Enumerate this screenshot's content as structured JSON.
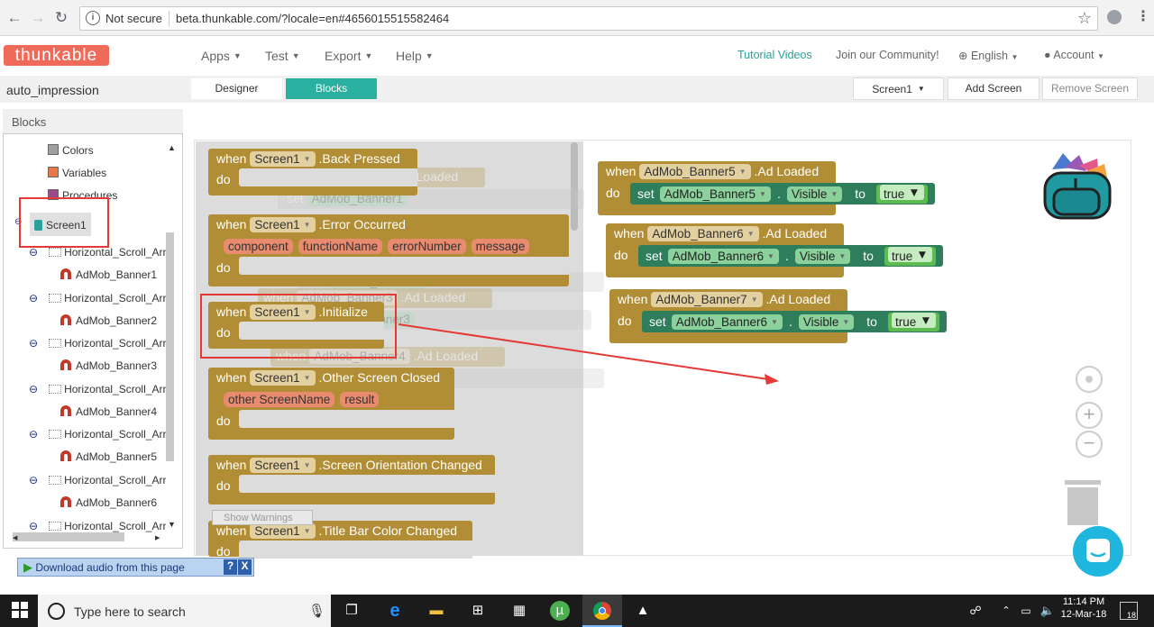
{
  "browser": {
    "security": "Not secure",
    "url": "beta.thunkable.com/?locale=en#4656015515582464"
  },
  "app": {
    "logo": "thunkable",
    "nav": [
      "Apps",
      "Test",
      "Export",
      "Help"
    ],
    "tutorial": "Tutorial Videos",
    "community": "Join our Community!",
    "language": "English",
    "account": "Account",
    "project_name": "auto_impression",
    "tabs": {
      "designer": "Designer",
      "blocks": "Blocks"
    },
    "screen_select": "Screen1",
    "add_screen": "Add Screen",
    "remove_screen": "Remove Screen"
  },
  "blocks_panel": {
    "title": "Blocks",
    "builtins": [
      {
        "label": "Colors",
        "color": "#a0a0a0"
      },
      {
        "label": "Variables",
        "color": "#e8784a"
      },
      {
        "label": "Procedures",
        "color": "#9a4a8a"
      }
    ],
    "screen": "Screen1",
    "tree": [
      {
        "parent": "Horizontal_Scroll_Arr",
        "child": "AdMob_Banner1"
      },
      {
        "parent": "Horizontal_Scroll_Arr",
        "child": "AdMob_Banner2"
      },
      {
        "parent": "Horizontal_Scroll_Arr",
        "child": "AdMob_Banner3"
      },
      {
        "parent": "Horizontal_Scroll_Arr",
        "child": "AdMob_Banner4"
      },
      {
        "parent": "Horizontal_Scroll_Arr",
        "child": "AdMob_Banner5"
      },
      {
        "parent": "Horizontal_Scroll_Arr",
        "child": "AdMob_Banner6"
      },
      {
        "parent": "Horizontal_Scroll_Arr",
        "child": ""
      }
    ]
  },
  "flyout": {
    "when": "when",
    "do": "do",
    "screen": "Screen1",
    "events": [
      {
        "event": ".Back Pressed",
        "params": []
      },
      {
        "event": ".Error Occurred",
        "params": [
          "component",
          "functionName",
          "errorNumber",
          "message"
        ]
      },
      {
        "event": ".Initialize",
        "params": []
      },
      {
        "event": ".Other Screen Closed",
        "params": [
          "other ScreenName",
          "result"
        ]
      },
      {
        "event": ".Screen Orientation Changed",
        "params": []
      },
      {
        "event": ".Title Bar Color Changed",
        "params": []
      }
    ],
    "show_warnings": "Show Warnings"
  },
  "ghost_blocks": [
    {
      "comp": "AdMob_Banner1",
      "event": ".Ad Loaded",
      "set_comp": "AdMob_Banner1"
    },
    {
      "comp": "AdMob_Banner2",
      "event": ".Ad Loaded",
      "set_comp": "AdMob_Banner2"
    },
    {
      "comp": "AdMob_Banner3",
      "event": ".Ad Loaded",
      "set_comp": "AdMob_Banner3"
    },
    {
      "comp": "AdMob_Banner4",
      "event": ".Ad Loaded",
      "set_comp": "AdMob_Banner4"
    }
  ],
  "workspace_blocks": [
    {
      "comp": "AdMob_Banner5",
      "event": ".Ad Loaded",
      "set_comp": "AdMob_Banner5",
      "prop": "Visible",
      "value": "true"
    },
    {
      "comp": "AdMob_Banner6",
      "event": ".Ad Loaded",
      "set_comp": "AdMob_Banner6",
      "prop": "Visible",
      "value": "true"
    },
    {
      "comp": "AdMob_Banner7",
      "event": ".Ad Loaded",
      "set_comp": "AdMob_Banner6",
      "prop": "Visible",
      "value": "true"
    }
  ],
  "words": {
    "set": "set",
    "to": "to",
    "dot": "."
  },
  "download_bar": "Download audio from this page",
  "taskbar": {
    "search": "Type here to search",
    "time": "11:14 PM",
    "date": "12-Mar-18",
    "notif_count": "18"
  }
}
